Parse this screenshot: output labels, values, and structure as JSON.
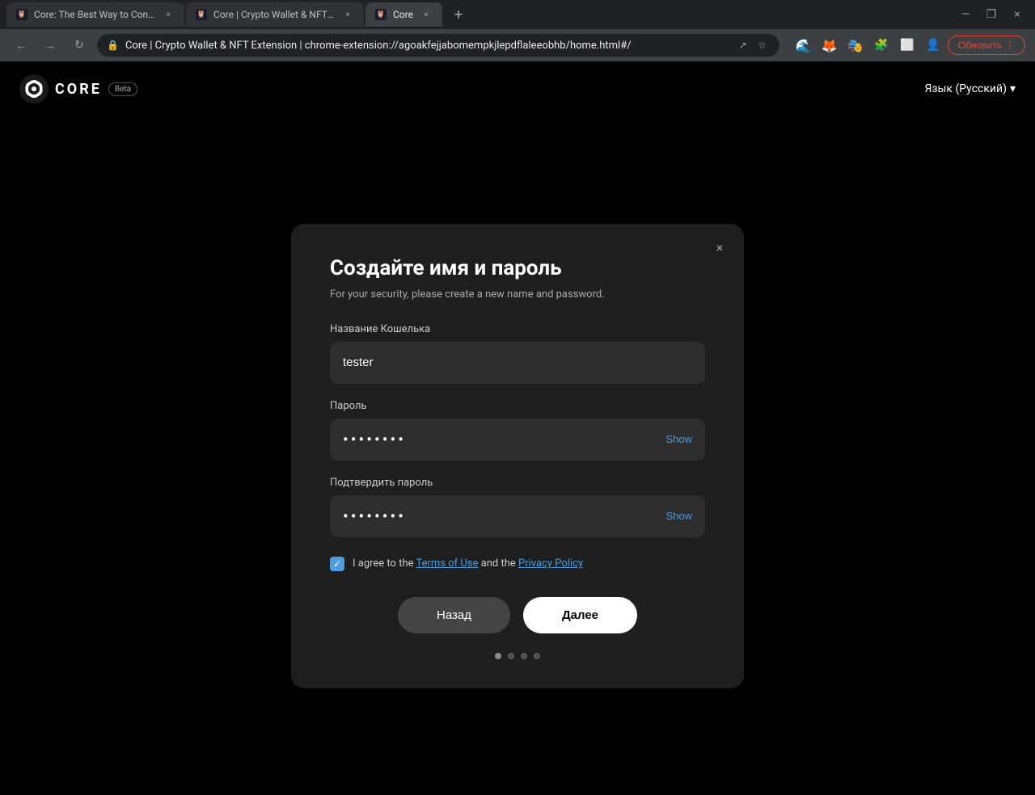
{
  "browser": {
    "tabs": [
      {
        "id": "tab1",
        "title": "Core: The Best Way to Connect t...",
        "favicon": "🦉",
        "active": false
      },
      {
        "id": "tab2",
        "title": "Core | Crypto Wallet & NFT Exte...",
        "favicon": "🦉",
        "active": false
      },
      {
        "id": "tab3",
        "title": "Core",
        "favicon": "🦉",
        "active": true
      }
    ],
    "address": "Core | Crypto Wallet & NFT Extension  |  chrome-extension://agoakfejjabomempkjlepdflaleeobhb/home.html#/",
    "update_button": "Обновить"
  },
  "header": {
    "logo_text": "CORE",
    "beta_label": "Beta",
    "lang_label": "Язык (Русский)",
    "lang_chevron": "▾"
  },
  "modal": {
    "title": "Создайте имя и пароль",
    "subtitle": "For your security, please create a new name and password.",
    "close_icon": "×",
    "wallet_name_label": "Название Кошелька",
    "wallet_name_value": "tester",
    "password_label": "Пароль",
    "password_dots": "••••••••",
    "show_label_1": "Show",
    "confirm_password_label": "Подтвердить пароль",
    "confirm_password_dots": "••••••••",
    "show_label_2": "Show",
    "terms_text_1": "I agree to the ",
    "terms_of_use": "Terms of Use",
    "terms_text_2": " and the ",
    "privacy_policy": "Privacy Policy",
    "back_button": "Назад",
    "next_button": "Далее",
    "pagination": {
      "dots": [
        {
          "active": true
        },
        {
          "active": false
        },
        {
          "active": false
        },
        {
          "active": false
        }
      ]
    }
  }
}
